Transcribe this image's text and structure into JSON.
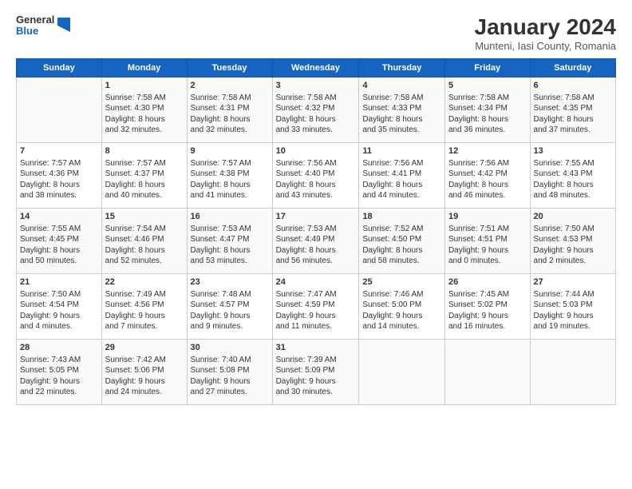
{
  "header": {
    "logo_line1": "General",
    "logo_line2": "Blue",
    "title": "January 2024",
    "subtitle": "Munteni, Iasi County, Romania"
  },
  "columns": [
    "Sunday",
    "Monday",
    "Tuesday",
    "Wednesday",
    "Thursday",
    "Friday",
    "Saturday"
  ],
  "weeks": [
    [
      {
        "day": "",
        "info": ""
      },
      {
        "day": "1",
        "info": "Sunrise: 7:58 AM\nSunset: 4:30 PM\nDaylight: 8 hours\nand 32 minutes."
      },
      {
        "day": "2",
        "info": "Sunrise: 7:58 AM\nSunset: 4:31 PM\nDaylight: 8 hours\nand 32 minutes."
      },
      {
        "day": "3",
        "info": "Sunrise: 7:58 AM\nSunset: 4:32 PM\nDaylight: 8 hours\nand 33 minutes."
      },
      {
        "day": "4",
        "info": "Sunrise: 7:58 AM\nSunset: 4:33 PM\nDaylight: 8 hours\nand 35 minutes."
      },
      {
        "day": "5",
        "info": "Sunrise: 7:58 AM\nSunset: 4:34 PM\nDaylight: 8 hours\nand 36 minutes."
      },
      {
        "day": "6",
        "info": "Sunrise: 7:58 AM\nSunset: 4:35 PM\nDaylight: 8 hours\nand 37 minutes."
      }
    ],
    [
      {
        "day": "7",
        "info": "Sunrise: 7:57 AM\nSunset: 4:36 PM\nDaylight: 8 hours\nand 38 minutes."
      },
      {
        "day": "8",
        "info": "Sunrise: 7:57 AM\nSunset: 4:37 PM\nDaylight: 8 hours\nand 40 minutes."
      },
      {
        "day": "9",
        "info": "Sunrise: 7:57 AM\nSunset: 4:38 PM\nDaylight: 8 hours\nand 41 minutes."
      },
      {
        "day": "10",
        "info": "Sunrise: 7:56 AM\nSunset: 4:40 PM\nDaylight: 8 hours\nand 43 minutes."
      },
      {
        "day": "11",
        "info": "Sunrise: 7:56 AM\nSunset: 4:41 PM\nDaylight: 8 hours\nand 44 minutes."
      },
      {
        "day": "12",
        "info": "Sunrise: 7:56 AM\nSunset: 4:42 PM\nDaylight: 8 hours\nand 46 minutes."
      },
      {
        "day": "13",
        "info": "Sunrise: 7:55 AM\nSunset: 4:43 PM\nDaylight: 8 hours\nand 48 minutes."
      }
    ],
    [
      {
        "day": "14",
        "info": "Sunrise: 7:55 AM\nSunset: 4:45 PM\nDaylight: 8 hours\nand 50 minutes."
      },
      {
        "day": "15",
        "info": "Sunrise: 7:54 AM\nSunset: 4:46 PM\nDaylight: 8 hours\nand 52 minutes."
      },
      {
        "day": "16",
        "info": "Sunrise: 7:53 AM\nSunset: 4:47 PM\nDaylight: 8 hours\nand 53 minutes."
      },
      {
        "day": "17",
        "info": "Sunrise: 7:53 AM\nSunset: 4:49 PM\nDaylight: 8 hours\nand 56 minutes."
      },
      {
        "day": "18",
        "info": "Sunrise: 7:52 AM\nSunset: 4:50 PM\nDaylight: 8 hours\nand 58 minutes."
      },
      {
        "day": "19",
        "info": "Sunrise: 7:51 AM\nSunset: 4:51 PM\nDaylight: 9 hours\nand 0 minutes."
      },
      {
        "day": "20",
        "info": "Sunrise: 7:50 AM\nSunset: 4:53 PM\nDaylight: 9 hours\nand 2 minutes."
      }
    ],
    [
      {
        "day": "21",
        "info": "Sunrise: 7:50 AM\nSunset: 4:54 PM\nDaylight: 9 hours\nand 4 minutes."
      },
      {
        "day": "22",
        "info": "Sunrise: 7:49 AM\nSunset: 4:56 PM\nDaylight: 9 hours\nand 7 minutes."
      },
      {
        "day": "23",
        "info": "Sunrise: 7:48 AM\nSunset: 4:57 PM\nDaylight: 9 hours\nand 9 minutes."
      },
      {
        "day": "24",
        "info": "Sunrise: 7:47 AM\nSunset: 4:59 PM\nDaylight: 9 hours\nand 11 minutes."
      },
      {
        "day": "25",
        "info": "Sunrise: 7:46 AM\nSunset: 5:00 PM\nDaylight: 9 hours\nand 14 minutes."
      },
      {
        "day": "26",
        "info": "Sunrise: 7:45 AM\nSunset: 5:02 PM\nDaylight: 9 hours\nand 16 minutes."
      },
      {
        "day": "27",
        "info": "Sunrise: 7:44 AM\nSunset: 5:03 PM\nDaylight: 9 hours\nand 19 minutes."
      }
    ],
    [
      {
        "day": "28",
        "info": "Sunrise: 7:43 AM\nSunset: 5:05 PM\nDaylight: 9 hours\nand 22 minutes."
      },
      {
        "day": "29",
        "info": "Sunrise: 7:42 AM\nSunset: 5:06 PM\nDaylight: 9 hours\nand 24 minutes."
      },
      {
        "day": "30",
        "info": "Sunrise: 7:40 AM\nSunset: 5:08 PM\nDaylight: 9 hours\nand 27 minutes."
      },
      {
        "day": "31",
        "info": "Sunrise: 7:39 AM\nSunset: 5:09 PM\nDaylight: 9 hours\nand 30 minutes."
      },
      {
        "day": "",
        "info": ""
      },
      {
        "day": "",
        "info": ""
      },
      {
        "day": "",
        "info": ""
      }
    ]
  ]
}
